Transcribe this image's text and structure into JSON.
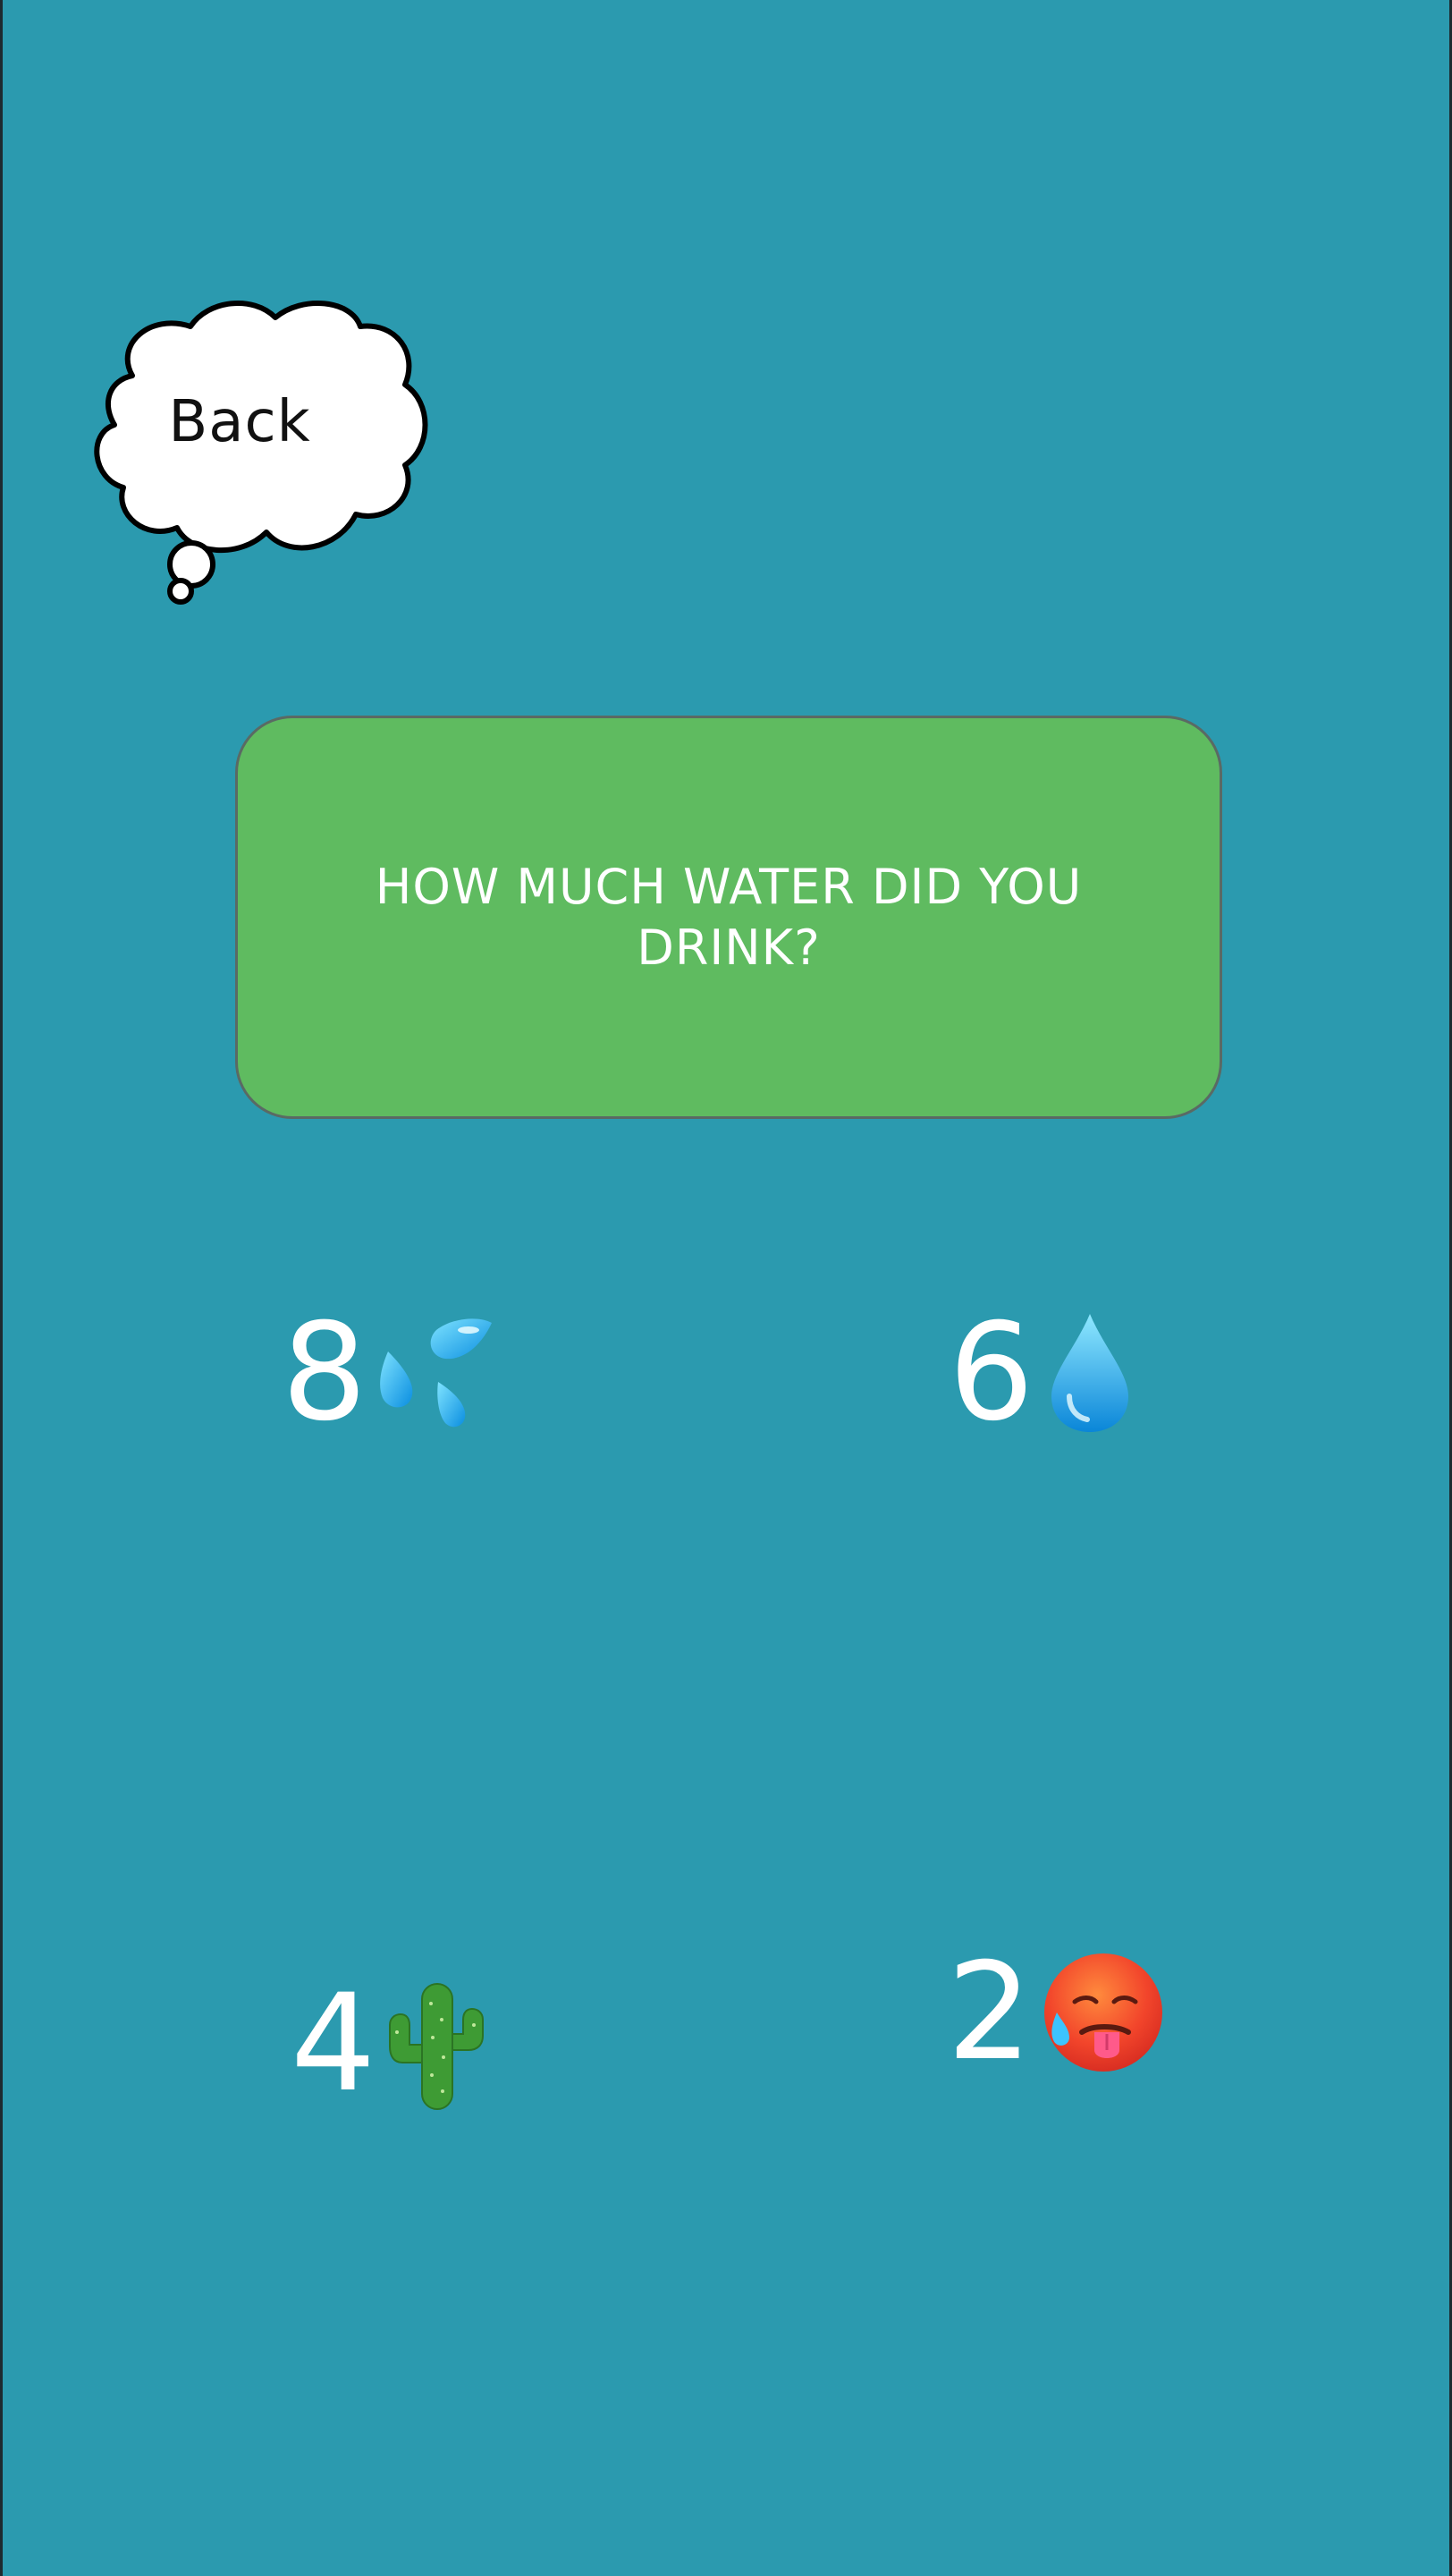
{
  "back_button": {
    "label": "Back"
  },
  "question": {
    "text": "HOW MUCH WATER DID YOU DRINK?"
  },
  "options": [
    {
      "value": "8",
      "icon": "sweat-droplets-icon"
    },
    {
      "value": "6",
      "icon": "droplet-icon"
    },
    {
      "value": "4",
      "icon": "cactus-icon"
    },
    {
      "value": "2",
      "icon": "hot-face-icon"
    }
  ],
  "colors": {
    "background": "#2b9aaf",
    "card": "#5fbb60",
    "text": "#ffffff"
  }
}
